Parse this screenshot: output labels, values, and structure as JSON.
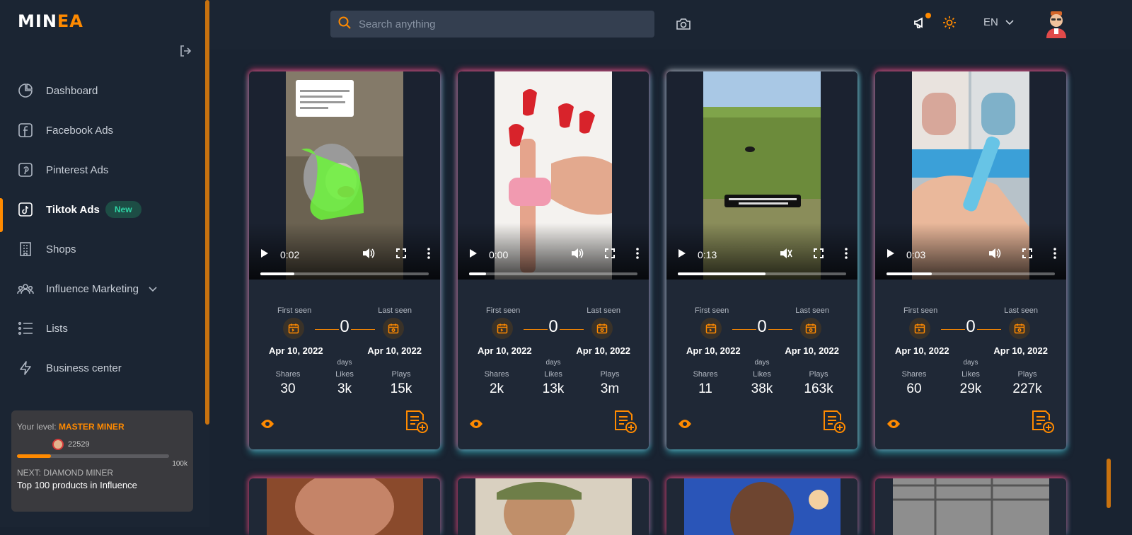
{
  "app": {
    "logo_prefix": "MIN",
    "logo_accent": "EA",
    "logo_i": "I"
  },
  "sidebar": {
    "items": [
      {
        "label": "Dashboard",
        "icon": "chart-pie-icon"
      },
      {
        "label": "Facebook Ads",
        "icon": "facebook-icon"
      },
      {
        "label": "Pinterest Ads",
        "icon": "pinterest-icon"
      },
      {
        "label": "Tiktok Ads",
        "icon": "tiktok-icon",
        "badge": "New",
        "active": true
      },
      {
        "label": "Shops",
        "icon": "building-icon"
      },
      {
        "label": "Influence Marketing",
        "icon": "users-icon"
      },
      {
        "label": "Lists",
        "icon": "list-icon"
      },
      {
        "label": "Business center",
        "icon": "lightning-icon"
      }
    ],
    "level": {
      "label": "Your level:",
      "name": "MASTER MINER",
      "points": "22529",
      "progress": 0.225,
      "max": "100k",
      "next_label": "NEXT: DIAMOND MINER",
      "next_desc": "Top 100 products in Influence"
    }
  },
  "topbar": {
    "search_placeholder": "Search anything",
    "language": "EN"
  },
  "labels": {
    "first_seen": "First seen",
    "last_seen": "Last seen",
    "days": "days",
    "shares": "Shares",
    "likes": "Likes",
    "plays": "Plays"
  },
  "cards": [
    {
      "time": "0:02",
      "progress": 0.2,
      "days": "0",
      "first": "Apr 10, 2022",
      "last": "Apr 10, 2022",
      "shares": "30",
      "likes": "3k",
      "plays": "15k",
      "muted": false
    },
    {
      "time": "0:00",
      "progress": 0.1,
      "days": "0",
      "first": "Apr 10, 2022",
      "last": "Apr 10, 2022",
      "shares": "2k",
      "likes": "13k",
      "plays": "3m",
      "muted": false
    },
    {
      "time": "0:13",
      "progress": 0.52,
      "days": "0",
      "first": "Apr 10, 2022",
      "last": "Apr 10, 2022",
      "shares": "11",
      "likes": "38k",
      "plays": "163k",
      "muted": true
    },
    {
      "time": "0:03",
      "progress": 0.27,
      "days": "0",
      "first": "Apr 10, 2022",
      "last": "Apr 10, 2022",
      "shares": "60",
      "likes": "29k",
      "plays": "227k",
      "muted": false
    }
  ],
  "colors": {
    "accent": "#ff8a00",
    "bg": "#192331",
    "panel": "#1f2836"
  }
}
